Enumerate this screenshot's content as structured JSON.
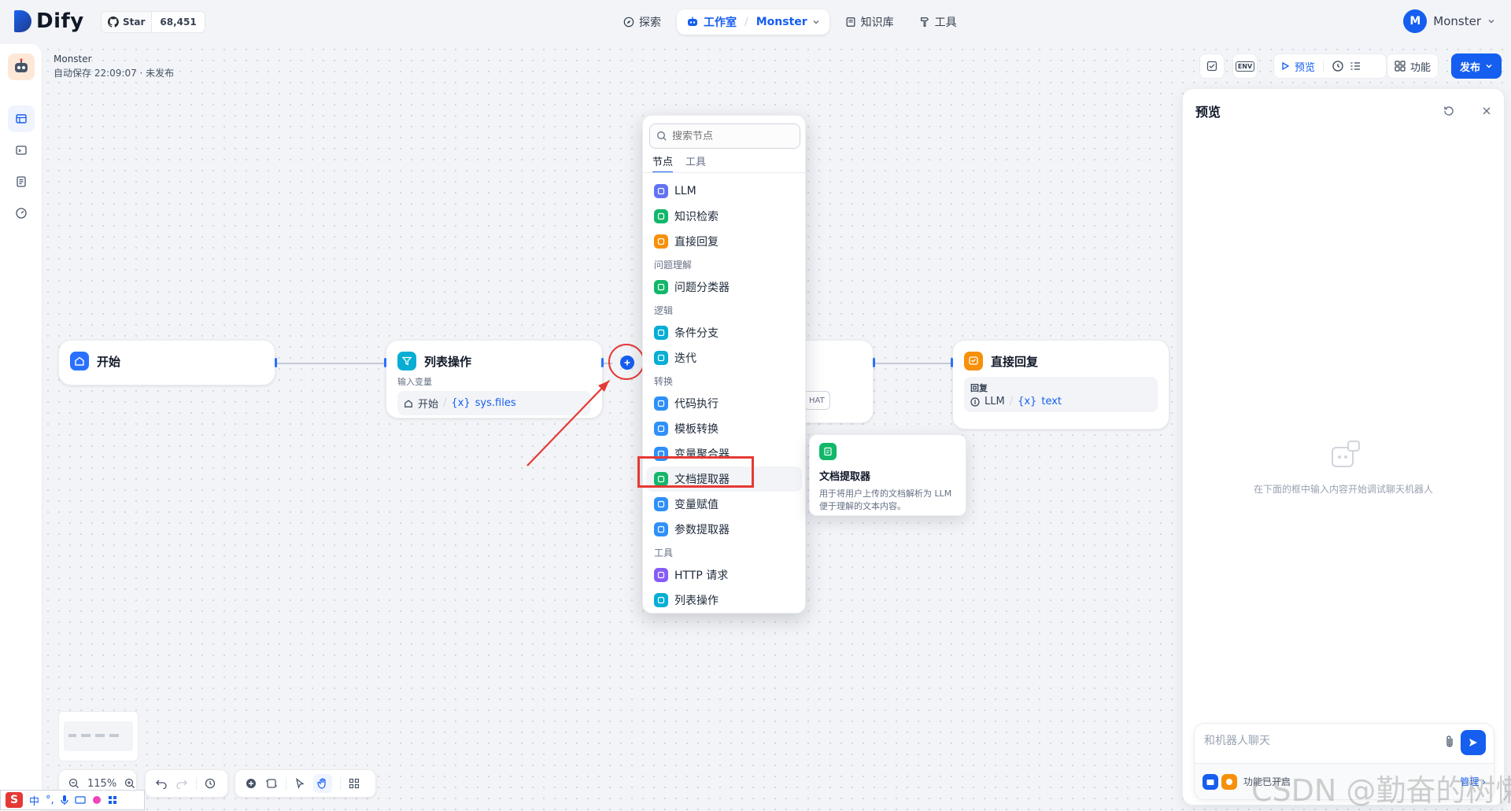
{
  "brand": {
    "name": "Dify"
  },
  "github": {
    "star_label": "Star",
    "count": "68,451"
  },
  "nav": {
    "explore": "探索",
    "studio": "工作室",
    "separator": "/",
    "app": "Monster",
    "knowledge": "知识库",
    "tools": "工具"
  },
  "user": {
    "initial": "M",
    "name": "Monster"
  },
  "app_info": {
    "name": "Monster",
    "status": "自动保存 22:09:07 · 未发布"
  },
  "toolbar": {
    "env_label": "ENV",
    "preview": "预览",
    "features": "功能",
    "publish": "发布"
  },
  "nodes": {
    "start": {
      "title": "开始"
    },
    "list_op": {
      "title": "列表操作",
      "sub_label": "输入变量",
      "var_source": "开始",
      "var_name": "sys.files"
    },
    "hidden_tag": "HAT",
    "reply": {
      "title": "直接回复",
      "sub_label": "回复",
      "var_source": "LLM",
      "var_name": "text"
    }
  },
  "menu": {
    "search_placeholder": "搜索节点",
    "tabs": [
      "节点",
      "工具"
    ],
    "items": [
      {
        "type": "item",
        "label": "LLM",
        "color": "#6172f3"
      },
      {
        "type": "item",
        "label": "知识检索",
        "color": "#12b76a"
      },
      {
        "type": "item",
        "label": "直接回复",
        "color": "#f79009"
      },
      {
        "type": "group",
        "label": "问题理解"
      },
      {
        "type": "item",
        "label": "问题分类器",
        "color": "#12b76a"
      },
      {
        "type": "group",
        "label": "逻辑"
      },
      {
        "type": "item",
        "label": "条件分支",
        "color": "#06aed4"
      },
      {
        "type": "item",
        "label": "迭代",
        "color": "#06aed4"
      },
      {
        "type": "group",
        "label": "转换"
      },
      {
        "type": "item",
        "label": "代码执行",
        "color": "#2e90fa"
      },
      {
        "type": "item",
        "label": "模板转换",
        "color": "#2e90fa"
      },
      {
        "type": "item",
        "label": "变量聚合器",
        "color": "#2e90fa"
      },
      {
        "type": "item",
        "label": "文档提取器",
        "color": "#12b76a",
        "highlight": true
      },
      {
        "type": "item",
        "label": "变量赋值",
        "color": "#2e90fa"
      },
      {
        "type": "item",
        "label": "参数提取器",
        "color": "#2e90fa"
      },
      {
        "type": "group",
        "label": "工具"
      },
      {
        "type": "item",
        "label": "HTTP 请求",
        "color": "#875bf7"
      },
      {
        "type": "item",
        "label": "列表操作",
        "color": "#06aed4"
      }
    ]
  },
  "tooltip": {
    "title": "文档提取器",
    "desc": "用于将用户上传的文档解析为 LLM 便于理解的文本内容。"
  },
  "preview_panel": {
    "title": "预览",
    "empty_text": "在下面的框中输入内容开始调试聊天机器人",
    "input_placeholder": "和机器人聊天",
    "features_enabled": "功能已开启",
    "manage": "管理 ›"
  },
  "canvas_controls": {
    "zoom": "115%"
  },
  "ime": {
    "logo": "S",
    "mode": "中"
  },
  "watermark": "CSDN @勤奋的树懒"
}
